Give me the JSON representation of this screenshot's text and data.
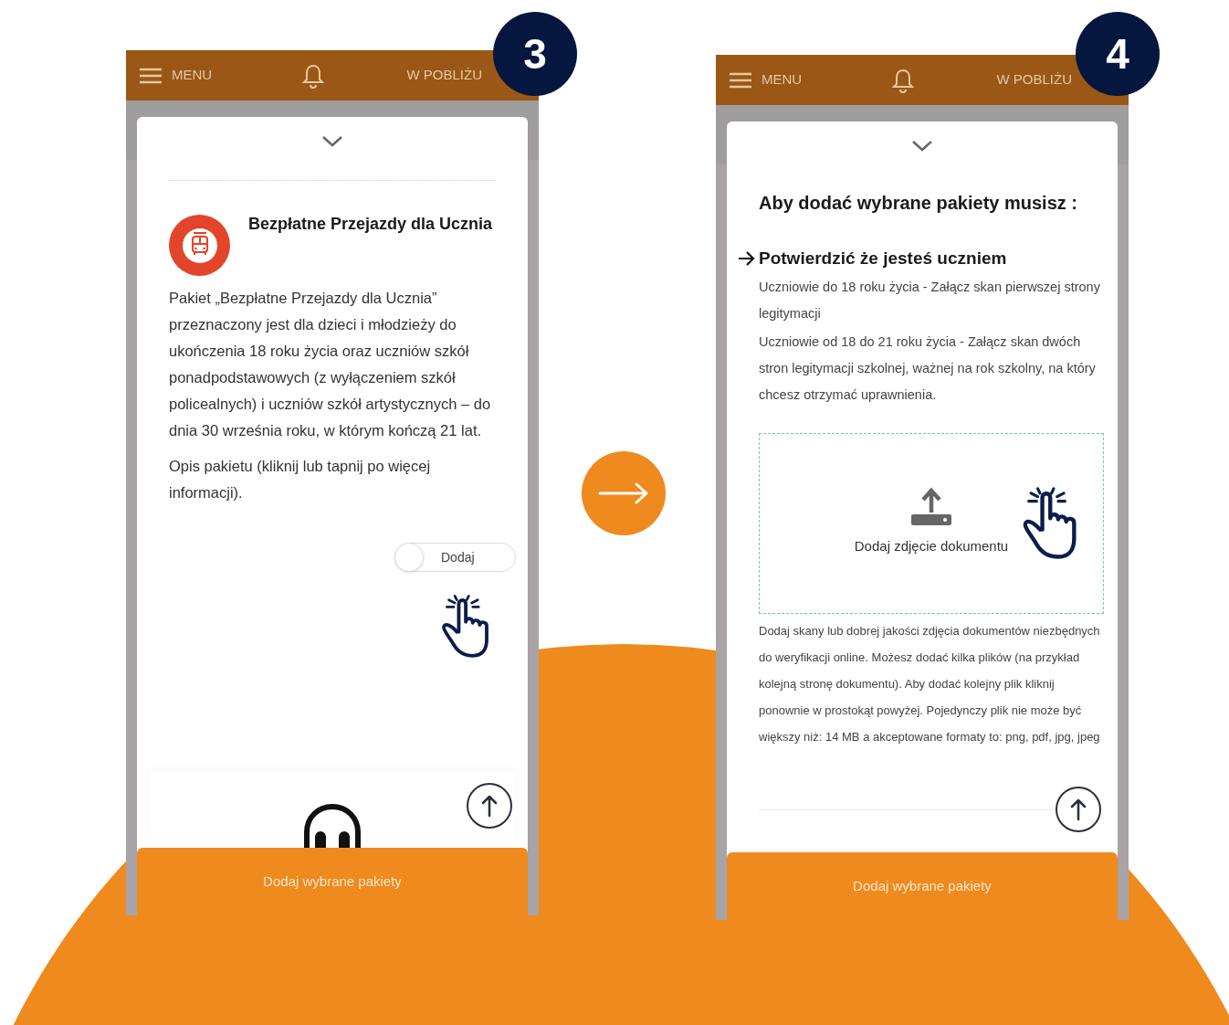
{
  "screens": [
    {
      "kind": "package",
      "step": "3",
      "header": {
        "menu": "MENU",
        "nearby": "W POBLIŻU"
      },
      "package": {
        "title": "Bezpłatne Przejazdy dla Ucznia",
        "description": "Pakiet „Bezpłatne Przejazdy dla Ucznia” przeznaczony jest dla dzieci i młodzieży do ukończenia 18 roku życia oraz uczniów szkół ponadpodstawowych (z wyłączeniem szkół policealnych) i uczniów szkół artystycznych – do dnia 30 września roku, w którym kończą 21 lat.",
        "more": "Opis pakietu (kliknij lub tapnij po więcej informacji).",
        "toggle": {
          "label": "Dodaj",
          "on": false
        }
      },
      "footer_button": "Dodaj wybrane pakiety"
    },
    {
      "kind": "upload",
      "step": "4",
      "header": {
        "menu": "MENU",
        "nearby": "W POBLIŻU"
      },
      "upload": {
        "heading": "Aby dodać wybrane pakiety musisz :",
        "requirement": "Potwierdzić że jesteś uczniem",
        "rules": [
          "Uczniowie do 18 roku życia - Załącz skan pierwszej strony legitymacji",
          "Uczniowie od 18 do 21 roku życia - Załącz skan dwóch stron legitymacji szkolnej, ważnej na rok szkolny, na który chcesz otrzymać uprawnienia."
        ],
        "dropzone_label": "Dodaj zdjęcie dokumentu",
        "help": "Dodaj skany lub dobrej jakości zdjęcia dokumentów niezbędnych do weryfikacji online. Możesz dodać kilka plików (na przykład kolejną stronę dokumentu). Aby dodać kolejny plik kliknij ponownie w prostokąt powyżej. Pojedynczy plik nie może być większy niż: 14 MB a akceptowane formaty to: png, pdf, jpg, jpeg"
      },
      "footer_button": "Dodaj wybrane pakiety"
    }
  ]
}
